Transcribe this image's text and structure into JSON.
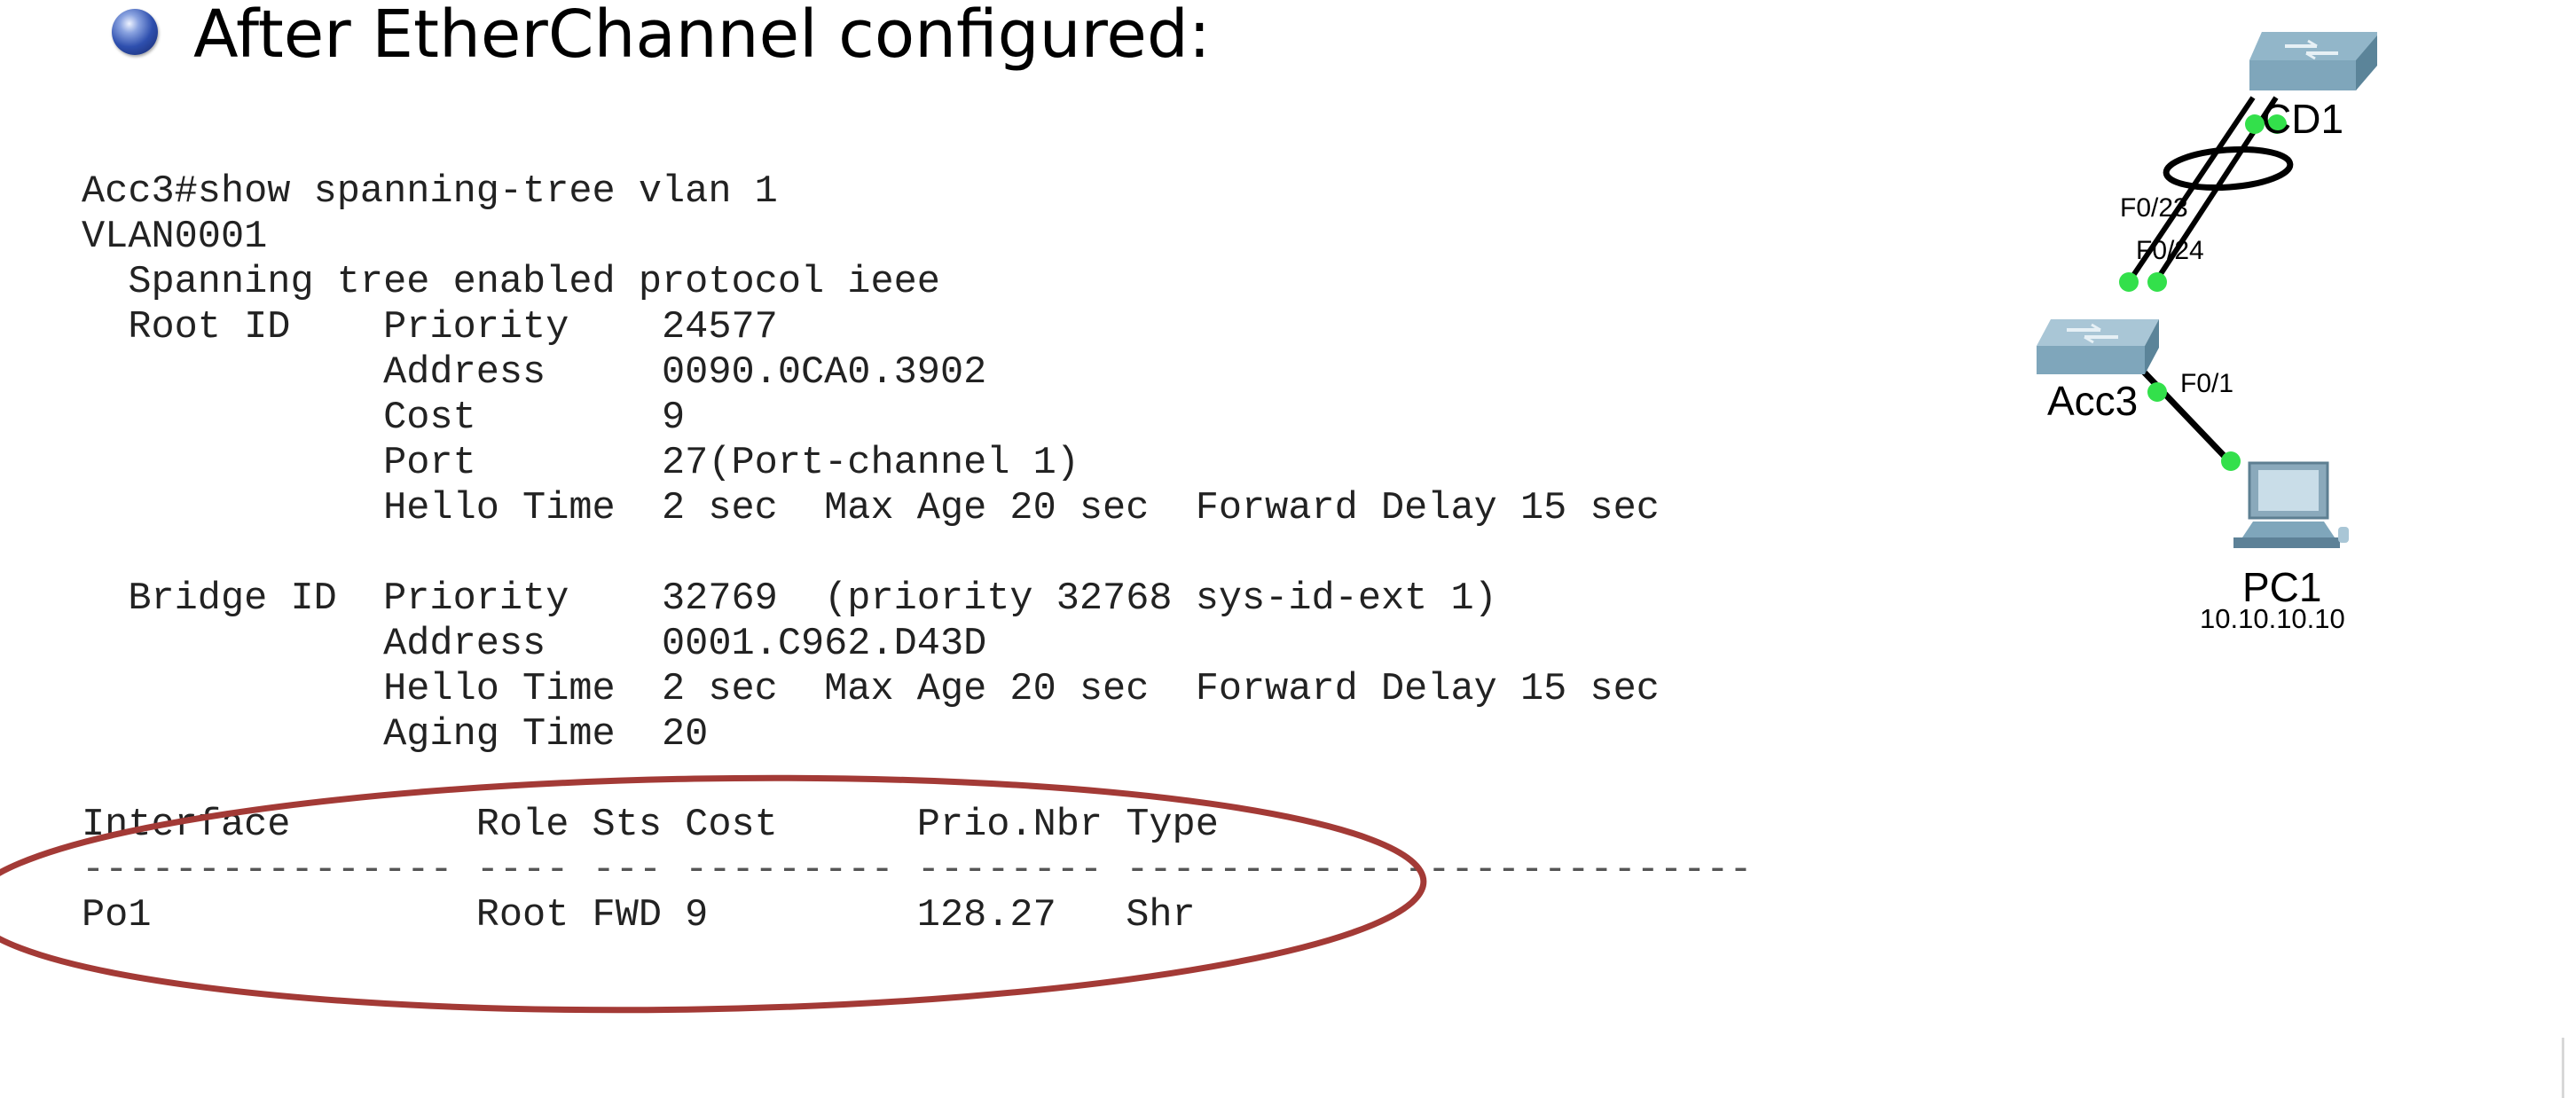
{
  "slide": {
    "title": "After EtherChannel configured:"
  },
  "cli": {
    "lines": [
      "Acc3#show spanning-tree vlan 1",
      "VLAN0001",
      "  Spanning tree enabled protocol ieee",
      "  Root ID    Priority    24577",
      "             Address     0090.0CA0.3902",
      "             Cost        9",
      "             Port        27(Port-channel 1)",
      "             Hello Time  2 sec  Max Age 20 sec  Forward Delay 15 sec",
      "",
      "  Bridge ID  Priority    32769  (priority 32768 sys-id-ext 1)",
      "             Address     0001.C962.D43D",
      "             Hello Time  2 sec  Max Age 20 sec  Forward Delay 15 sec",
      "             Aging Time  20",
      "",
      "Interface        Role Sts Cost      Prio.Nbr Type",
      "---------------- ---- --- --------- -------- ---------------------------",
      "Po1              Root FWD 9         128.27   Shr"
    ]
  },
  "topology": {
    "devices": {
      "core_switch": "CD1",
      "access_switch": "Acc3",
      "pc": "PC1",
      "pc_ip": "10.10.10.10"
    },
    "ports": {
      "f023": "F0/23",
      "f024": "F0/24",
      "f01": "F0/1"
    }
  },
  "colors": {
    "highlight_ellipse": "#a33a36",
    "link_up_dot": "#33e04b",
    "link_line": "#000000",
    "switch_body": "#7fa6bb"
  }
}
